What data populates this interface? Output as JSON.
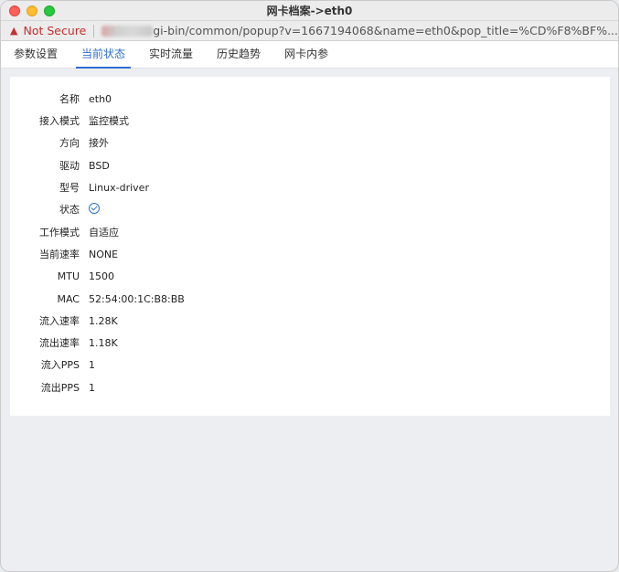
{
  "window": {
    "title": "网卡档案->eth0"
  },
  "urlbar": {
    "security_label": "Not Secure",
    "url_visible": "gi-bin/common/popup?v=1667194068&name=eth0&pop_title=%CD%F8%BF%..."
  },
  "tabs": [
    {
      "label": "参数设置",
      "active": false
    },
    {
      "label": "当前状态",
      "active": true
    },
    {
      "label": "实时流量",
      "active": false
    },
    {
      "label": "历史趋势",
      "active": false
    },
    {
      "label": "网卡内参",
      "active": false
    }
  ],
  "details": [
    {
      "label": "名称",
      "value": "eth0"
    },
    {
      "label": "接入模式",
      "value": "监控模式"
    },
    {
      "label": "方向",
      "value": "接外"
    },
    {
      "label": "驱动",
      "value": "BSD"
    },
    {
      "label": "型号",
      "value": "Linux-driver"
    },
    {
      "label": "状态",
      "value": "",
      "icon": "check-circle-icon"
    },
    {
      "label": "工作模式",
      "value": "自适应"
    },
    {
      "label": "当前速率",
      "value": "NONE"
    },
    {
      "label": "MTU",
      "value": "1500"
    },
    {
      "label": "MAC",
      "value": "52:54:00:1C:B8:BB"
    },
    {
      "label": "流入速率",
      "value": "1.28K"
    },
    {
      "label": "流出速率",
      "value": "1.18K"
    },
    {
      "label": "流入PPS",
      "value": "1"
    },
    {
      "label": "流出PPS",
      "value": "1"
    }
  ],
  "colors": {
    "accent": "#2f6fd1",
    "warning": "#c4302b"
  }
}
